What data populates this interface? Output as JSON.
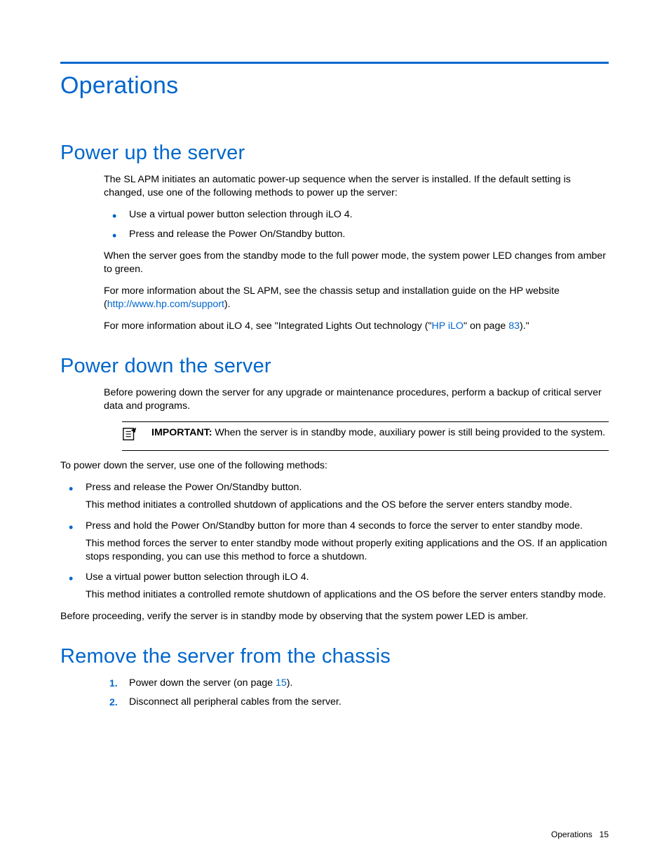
{
  "chapter_title": "Operations",
  "sections": {
    "power_up": {
      "title": "Power up the server",
      "intro": "The SL APM initiates an automatic power-up sequence when the server is installed. If the default setting is changed, use one of the following methods to power up the server:",
      "bullets": [
        "Use a virtual power button selection through iLO 4.",
        "Press and release the Power On/Standby button."
      ],
      "p2": "When the server goes from the standby mode to the full power mode, the system power LED changes from amber to green.",
      "p3_pre": "For more information about the SL APM, see the chassis setup and installation guide on the HP website (",
      "p3_link": "http://www.hp.com/support",
      "p3_post": ").",
      "p4_pre": "For more information about iLO 4, see \"Integrated Lights Out technology (\"",
      "p4_link1": "HP iLO",
      "p4_mid": "\" on page ",
      "p4_link2": "83",
      "p4_post": ").\""
    },
    "power_down": {
      "title": "Power down the server",
      "intro": "Before powering down the server for any upgrade or maintenance procedures, perform a backup of critical server data and programs.",
      "important_label": "IMPORTANT:",
      "important_text": "   When the server is in standby mode, auxiliary power is still being provided to the system.",
      "p2": "To power down the server, use one of the following methods:",
      "bullets": [
        {
          "main": "Press and release the Power On/Standby button.",
          "sub": "This method initiates a controlled shutdown of applications and the OS before the server enters standby mode."
        },
        {
          "main": "Press and hold the Power On/Standby button for more than 4 seconds to force the server to enter standby mode.",
          "sub": "This method forces the server to enter standby mode without properly exiting applications and the OS. If an application stops responding, you can use this method to force a shutdown."
        },
        {
          "main": "Use a virtual power button selection through iLO 4.",
          "sub": "This method initiates a controlled remote shutdown of applications and the OS before the server enters standby mode."
        }
      ],
      "p3": "Before proceeding, verify the server is in standby mode by observing that the system power LED is amber."
    },
    "remove": {
      "title": "Remove the server from the chassis",
      "steps": [
        {
          "pre": "Power down the server (on page ",
          "link": "15",
          "post": ")."
        },
        {
          "text": "Disconnect all peripheral cables from the server."
        }
      ]
    }
  },
  "footer": {
    "section": "Operations",
    "page": "15"
  }
}
